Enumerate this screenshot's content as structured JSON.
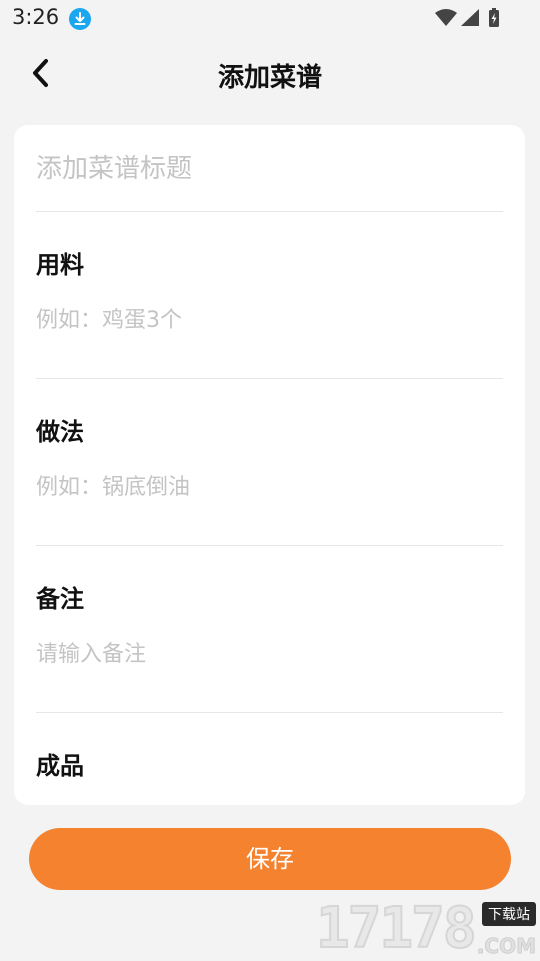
{
  "status_bar": {
    "time": "3:26",
    "icons": [
      "download-icon",
      "wifi-icon",
      "signal-icon",
      "battery-charging-icon"
    ]
  },
  "header": {
    "title": "添加菜谱",
    "back_icon": "chevron-left-icon"
  },
  "form": {
    "title_placeholder": "添加菜谱标题",
    "sections": [
      {
        "label": "用料",
        "placeholder": "例如：鸡蛋3个"
      },
      {
        "label": "做法",
        "placeholder": "例如：锅底倒油"
      },
      {
        "label": "备注",
        "placeholder": "请输入备注"
      },
      {
        "label": "成品"
      }
    ]
  },
  "save_label": "保存",
  "watermark": {
    "number": "17178",
    "tag": "下载站",
    "suffix": ".COM"
  },
  "colors": {
    "accent": "#f5822f",
    "background": "#f3f3f3",
    "card": "#ffffff",
    "download_badge": "#1aa7f0"
  }
}
